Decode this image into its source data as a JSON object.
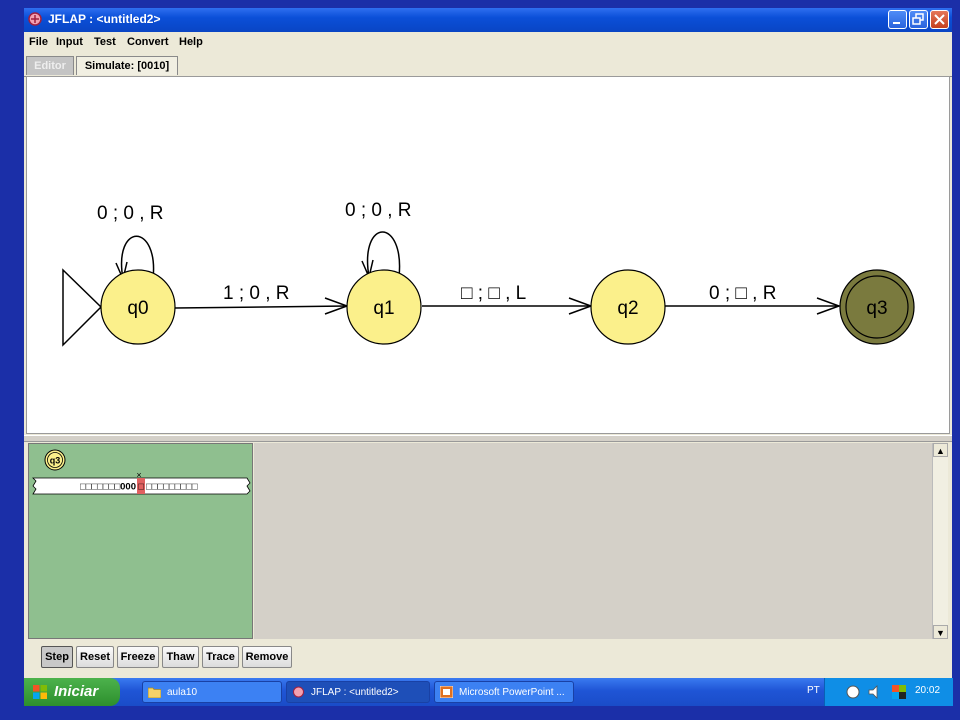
{
  "window": {
    "title": "JFLAP : <untitled2>"
  },
  "menu": [
    "File",
    "Input",
    "Test",
    "Convert",
    "Help"
  ],
  "tabs": {
    "editor": "Editor",
    "simulate": "Simulate: [0010]"
  },
  "states": {
    "q0": "q0",
    "q1": "q1",
    "q2": "q2",
    "q3": "q3"
  },
  "transitions": {
    "q0_loop": "0 ; 0 , R",
    "q0_q1": "1 ; 0 , R",
    "q1_loop": "0 ; 0 , R",
    "q1_q2": "□ ; □ , L",
    "q2_q3": "0 ; □ , R"
  },
  "simulation": {
    "current_state": "q3",
    "tape_left": "□□□□□□□000",
    "tape_head": "□",
    "tape_right": "□□□□□□□□□"
  },
  "buttons": [
    "Step",
    "Reset",
    "Freeze",
    "Thaw",
    "Trace",
    "Remove"
  ],
  "taskbar": {
    "start": "Iniciar",
    "items": [
      "aula10",
      "JFLAP : <untitled2>",
      "Microsoft PowerPoint ..."
    ],
    "lang": "PT",
    "clock": "20:02"
  }
}
